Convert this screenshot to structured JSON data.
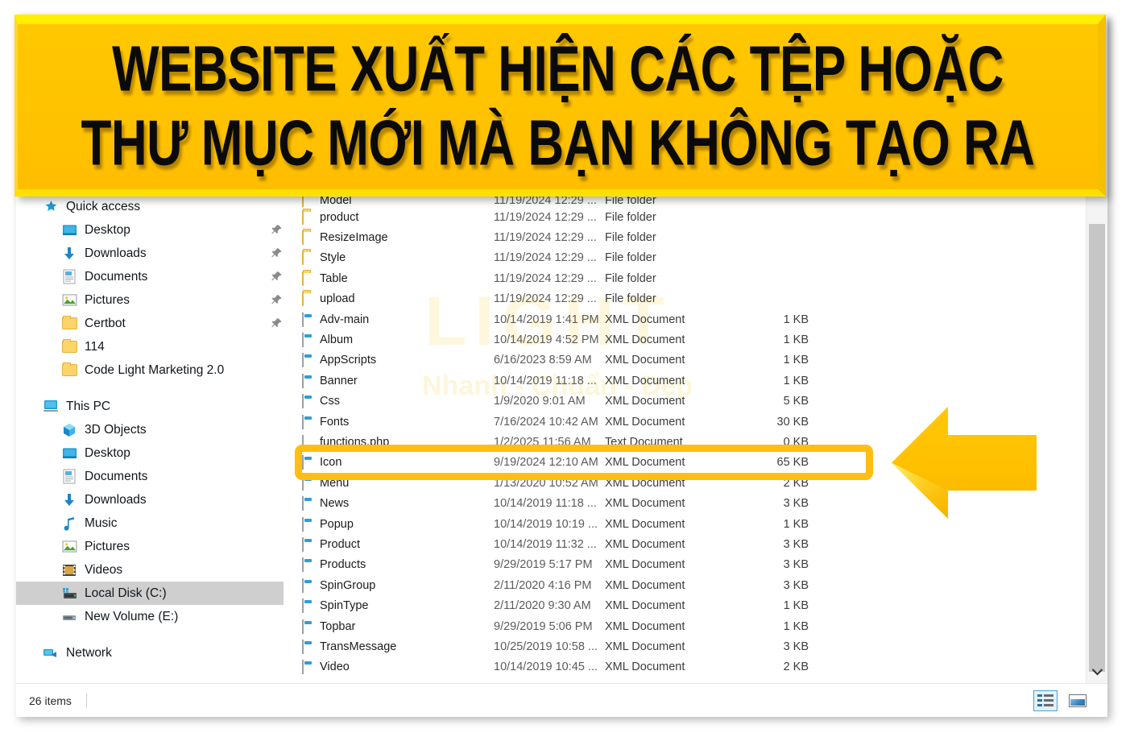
{
  "banner": {
    "line1": "WEBSITE XUẤT HIỆN CÁC TỆP HOẶC",
    "line2": "THƯ MỤC MỚI MÀ BẠN KHÔNG TẠO RA",
    "bg_color": "#ffc000",
    "text_color": "#000000"
  },
  "watermark": {
    "brand": "LIGHT",
    "tagline": "Nhanh - Chuẩn - Đẹp",
    "color": "#fccb2e"
  },
  "sidebar": {
    "groups": [
      {
        "header": {
          "label": "Quick access",
          "icon": "star-icon",
          "level": 0
        },
        "items": [
          {
            "label": "Desktop",
            "icon": "desktop-icon",
            "pinned": true,
            "level": 1
          },
          {
            "label": "Downloads",
            "icon": "download-icon",
            "pinned": true,
            "level": 1
          },
          {
            "label": "Documents",
            "icon": "documents-icon",
            "pinned": true,
            "level": 1
          },
          {
            "label": "Pictures",
            "icon": "pictures-icon",
            "pinned": true,
            "level": 1
          },
          {
            "label": "Certbot",
            "icon": "folder-icon",
            "pinned": true,
            "level": 1
          },
          {
            "label": "114",
            "icon": "folder-icon",
            "pinned": false,
            "level": 1
          },
          {
            "label": "Code Light Marketing 2.0",
            "icon": "folder-icon",
            "pinned": false,
            "level": 1
          }
        ]
      },
      {
        "header": {
          "label": "This PC",
          "icon": "this-pc-icon",
          "level": 0
        },
        "items": [
          {
            "label": "3D Objects",
            "icon": "3d-objects-icon",
            "pinned": false,
            "level": 1
          },
          {
            "label": "Desktop",
            "icon": "desktop-icon",
            "pinned": false,
            "level": 1
          },
          {
            "label": "Documents",
            "icon": "documents-icon",
            "pinned": false,
            "level": 1
          },
          {
            "label": "Downloads",
            "icon": "download-icon",
            "pinned": false,
            "level": 1
          },
          {
            "label": "Music",
            "icon": "music-icon",
            "pinned": false,
            "level": 1
          },
          {
            "label": "Pictures",
            "icon": "pictures-icon",
            "pinned": false,
            "level": 1
          },
          {
            "label": "Videos",
            "icon": "videos-icon",
            "pinned": false,
            "level": 1
          },
          {
            "label": "Local Disk (C:)",
            "icon": "hard-disk-icon",
            "pinned": false,
            "level": 1,
            "selected": true
          },
          {
            "label": "New Volume (E:)",
            "icon": "drive-icon",
            "pinned": false,
            "level": 1
          }
        ]
      },
      {
        "header": {
          "label": "Network",
          "icon": "network-icon",
          "level": 0
        },
        "items": []
      }
    ]
  },
  "filelist": {
    "rows": [
      {
        "name": "Model",
        "date": "11/19/2024 12:29 ...",
        "type": "File folder",
        "size": "",
        "icon": "folder-icon",
        "clipped": "top"
      },
      {
        "name": "product",
        "date": "11/19/2024 12:29 ...",
        "type": "File folder",
        "size": "",
        "icon": "folder-icon"
      },
      {
        "name": "ResizeImage",
        "date": "11/19/2024 12:29 ...",
        "type": "File folder",
        "size": "",
        "icon": "folder-icon"
      },
      {
        "name": "Style",
        "date": "11/19/2024 12:29 ...",
        "type": "File folder",
        "size": "",
        "icon": "folder-icon"
      },
      {
        "name": "Table",
        "date": "11/19/2024 12:29 ...",
        "type": "File folder",
        "size": "",
        "icon": "folder-icon"
      },
      {
        "name": "upload",
        "date": "11/19/2024 12:29 ...",
        "type": "File folder",
        "size": "",
        "icon": "folder-icon"
      },
      {
        "name": "Adv-main",
        "date": "10/14/2019 1:41 PM",
        "type": "XML Document",
        "size": "1 KB",
        "icon": "xml-document-icon"
      },
      {
        "name": "Album",
        "date": "10/14/2019 4:52 PM",
        "type": "XML Document",
        "size": "1 KB",
        "icon": "xml-document-icon"
      },
      {
        "name": "AppScripts",
        "date": "6/16/2023 8:59 AM",
        "type": "XML Document",
        "size": "1 KB",
        "icon": "xml-document-icon"
      },
      {
        "name": "Banner",
        "date": "10/14/2019 11:18 ...",
        "type": "XML Document",
        "size": "1 KB",
        "icon": "xml-document-icon"
      },
      {
        "name": "Css",
        "date": "1/9/2020 9:01 AM",
        "type": "XML Document",
        "size": "5 KB",
        "icon": "xml-document-icon"
      },
      {
        "name": "Fonts",
        "date": "7/16/2024 10:42 AM",
        "type": "XML Document",
        "size": "30 KB",
        "icon": "xml-document-icon"
      },
      {
        "name": "functions.php",
        "date": "1/2/2025 11:56 AM",
        "type": "Text Document",
        "size": "0 KB",
        "icon": "text-document-icon",
        "highlighted": true
      },
      {
        "name": "Icon",
        "date": "9/19/2024 12:10 AM",
        "type": "XML Document",
        "size": "65 KB",
        "icon": "xml-document-icon"
      },
      {
        "name": "Menu",
        "date": "1/13/2020 10:52 AM",
        "type": "XML Document",
        "size": "2 KB",
        "icon": "xml-document-icon"
      },
      {
        "name": "News",
        "date": "10/14/2019 11:18 ...",
        "type": "XML Document",
        "size": "3 KB",
        "icon": "xml-document-icon"
      },
      {
        "name": "Popup",
        "date": "10/14/2019 10:19 ...",
        "type": "XML Document",
        "size": "1 KB",
        "icon": "xml-document-icon"
      },
      {
        "name": "Product",
        "date": "10/14/2019 11:32 ...",
        "type": "XML Document",
        "size": "3 KB",
        "icon": "xml-document-icon"
      },
      {
        "name": "Products",
        "date": "9/29/2019 5:17 PM",
        "type": "XML Document",
        "size": "3 KB",
        "icon": "xml-document-icon"
      },
      {
        "name": "SpinGroup",
        "date": "2/11/2020 4:16 PM",
        "type": "XML Document",
        "size": "3 KB",
        "icon": "xml-document-icon"
      },
      {
        "name": "SpinType",
        "date": "2/11/2020 9:30 AM",
        "type": "XML Document",
        "size": "1 KB",
        "icon": "xml-document-icon"
      },
      {
        "name": "Topbar",
        "date": "9/29/2019 5:06 PM",
        "type": "XML Document",
        "size": "1 KB",
        "icon": "xml-document-icon"
      },
      {
        "name": "TransMessage",
        "date": "10/25/2019 10:58 ...",
        "type": "XML Document",
        "size": "3 KB",
        "icon": "xml-document-icon"
      },
      {
        "name": "Video",
        "date": "10/14/2019 10:45 ...",
        "type": "XML Document",
        "size": "2 KB",
        "icon": "xml-document-icon"
      }
    ]
  },
  "annotation": {
    "highlight_color": "#ffbe11",
    "arrow_color": "#ffc000",
    "arrow_direction": "left",
    "target_row": "functions.php"
  },
  "statusbar": {
    "item_count": "26 items",
    "views": [
      {
        "name": "details-view-button",
        "icon": "details-icon",
        "active": true
      },
      {
        "name": "large-icons-view-button",
        "icon": "large-icons-icon",
        "active": false
      }
    ]
  },
  "scrollbar": {
    "down_arrow": "⌄"
  }
}
